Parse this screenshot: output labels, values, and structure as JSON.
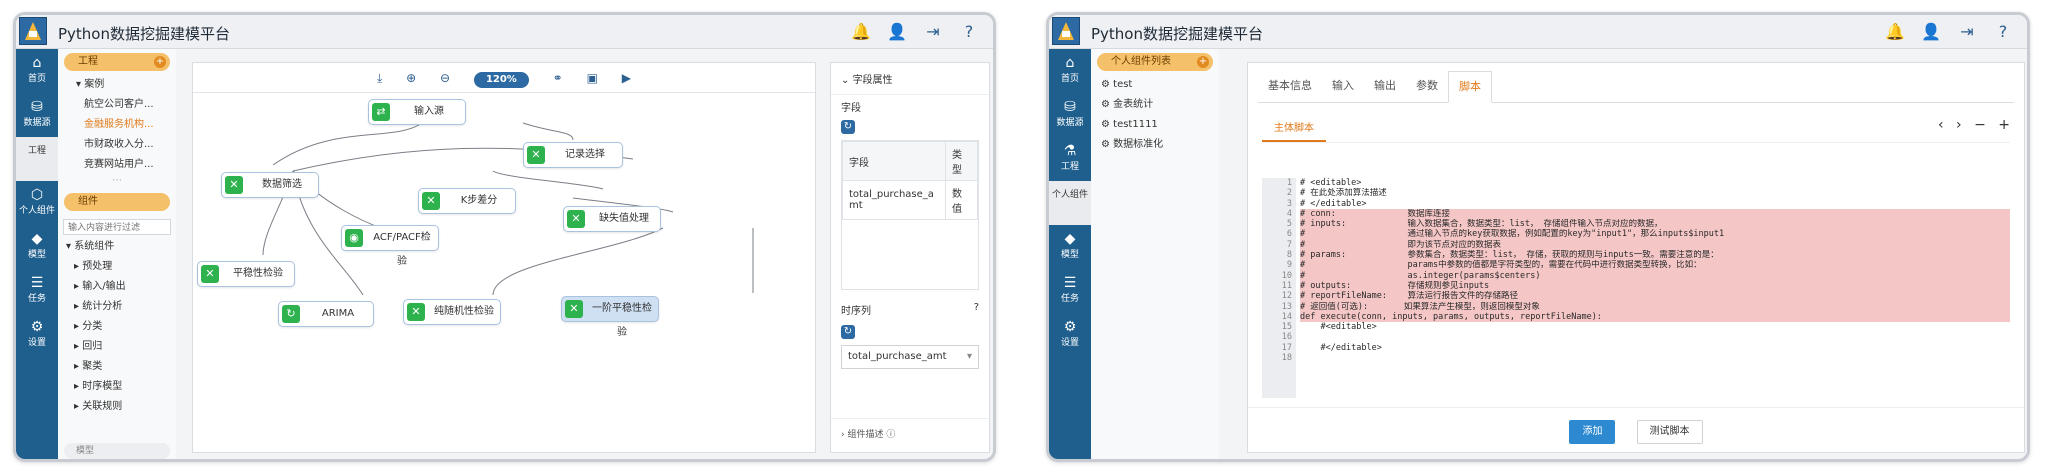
{
  "app": {
    "title": "Python数据挖掘建模平台"
  },
  "icons": [
    "bell-icon",
    "user-icon",
    "logout-icon",
    "help-icon"
  ],
  "nav_left": [
    {
      "icon": "⌂",
      "label": "首页"
    },
    {
      "icon": "⛁",
      "label": "数据源"
    },
    {
      "icon": "",
      "label": "工程"
    },
    {
      "icon": "⬡",
      "label": "个人组件"
    },
    {
      "icon": "◆",
      "label": "模型"
    },
    {
      "icon": "☰",
      "label": "任务"
    },
    {
      "icon": "⚙",
      "label": "设置"
    }
  ],
  "nav_right": [
    {
      "icon": "⌂",
      "label": "首页"
    },
    {
      "icon": "⛁",
      "label": "数据源"
    },
    {
      "icon": "⚗",
      "label": "工程"
    },
    {
      "icon": "",
      "label": "个人组件"
    },
    {
      "icon": "◆",
      "label": "模型"
    },
    {
      "icon": "☰",
      "label": "任务"
    },
    {
      "icon": "⚙",
      "label": "设置"
    }
  ],
  "project_panel": {
    "header": "工程",
    "tree": [
      "▾ 案例",
      "航空公司客户...",
      "金融服务机构...",
      "市财政收入分...",
      "竞赛网站用户..."
    ],
    "selected_index": 2
  },
  "component_panel": {
    "header": "组件",
    "search_placeholder": "输入内容进行过滤",
    "tree": [
      "▾ 系统组件",
      "▸ 预处理",
      "▸ 输入/输出",
      "▸ 统计分析",
      "▸ 分类",
      "▸ 回归",
      "▸ 聚类",
      "▸ 时序模型",
      "▸ 关联规则"
    ],
    "footer": "模型"
  },
  "toolbar": {
    "icons": [
      "⤓",
      "⊕",
      "⊖"
    ],
    "zoom": "120%",
    "icons2": [
      "⚭",
      "▣",
      "▶"
    ]
  },
  "nodes": [
    {
      "label": "输入源",
      "icon": "⇄"
    },
    {
      "label": "记录选择",
      "icon": "✕"
    },
    {
      "label": "数据筛选",
      "icon": "✕"
    },
    {
      "label": "K步差分",
      "icon": "✕"
    },
    {
      "label": "缺失值处理",
      "icon": "✕"
    },
    {
      "label": "ACF/PACF检验",
      "icon": "◉"
    },
    {
      "label": "平稳性检验",
      "icon": "✕"
    },
    {
      "label": "ARIMA",
      "icon": "↻"
    },
    {
      "label": "纯随机性检验",
      "icon": "✕"
    },
    {
      "label": "一阶平稳性检验",
      "icon": "✕"
    }
  ],
  "props": {
    "header": "字段属性",
    "field_label": "字段",
    "col_field": "字段",
    "col_type": "类型",
    "row_field": "total_purchase_amt",
    "row_type": "数值",
    "ts_label": "时序列",
    "ts_value": "total_purchase_amt",
    "desc": "组件描述"
  },
  "personal": {
    "header": "个人组件列表",
    "items": [
      "test",
      "金表统计",
      "test1111",
      "数据标准化"
    ]
  },
  "editor": {
    "tabs": [
      "基本信息",
      "输入",
      "输出",
      "参数",
      "脚本"
    ],
    "active_tab": 4,
    "subtab": "主体脚本",
    "controls": [
      "‹",
      "›",
      "−",
      "+"
    ],
    "lines": [
      "# <editable>",
      "# 在此处添加算法描述",
      "# </editable>",
      "# conn:              数据库连接",
      "# inputs:            输入数据集合，数据类型：list， 存储组件输入节点对应的数据，",
      "#                    通过输入节点的key获取数据，例如配置的key为\"input1\"，那么inputs$input1",
      "#                    即为该节点对应的数据表",
      "# params:            参数集合，数据类型：list， 存储，获取的规则与inputs一致。需要注意的是：",
      "#                    params中参数的值都是字符类型的，需要在代码中进行数据类型转换，比如：",
      "#                    as.integer(params$centers)",
      "# outputs:           存储规则参见inputs",
      "# reportFileName:    算法运行报告文件的存储路径",
      "# 返回值(可选):       如果算法产生模型，则返回模型对象",
      "def execute(conn, inputs, params, outputs, reportFileName):",
      "    #<editable>",
      "",
      "    #</editable>",
      ""
    ],
    "highlight": [
      3,
      4,
      5,
      6,
      7,
      8,
      9,
      10,
      11,
      12,
      13
    ],
    "btn_add": "添加",
    "btn_test": "测试脚本"
  }
}
